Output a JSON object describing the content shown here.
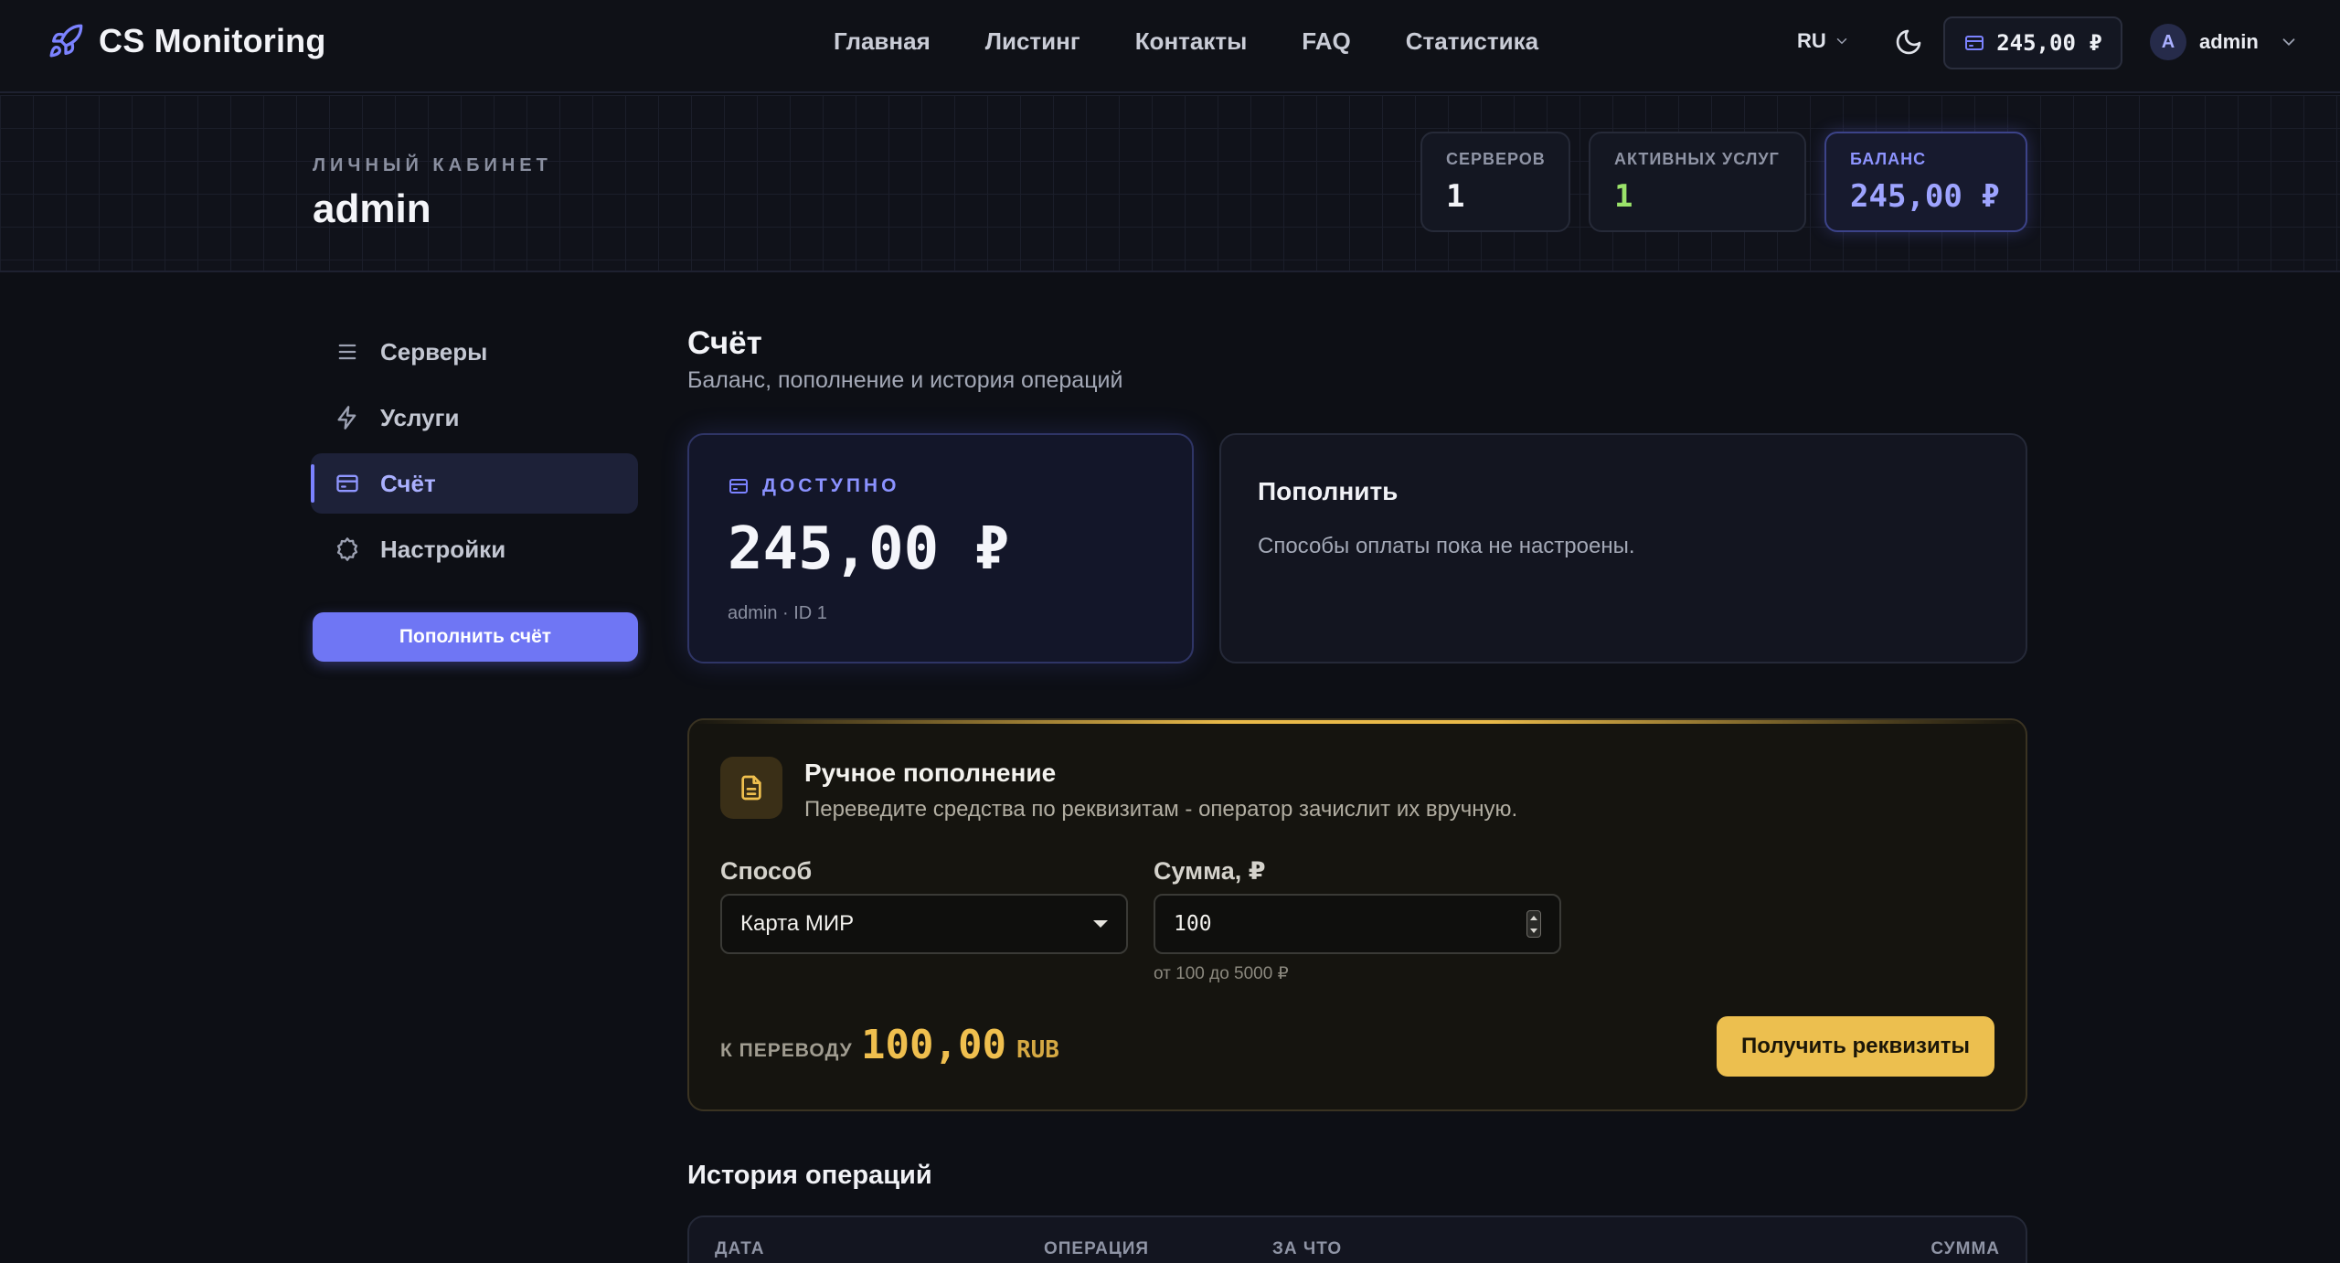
{
  "app": {
    "name": "CS Monitoring"
  },
  "nav": {
    "items": [
      "Главная",
      "Листинг",
      "Контакты",
      "FAQ",
      "Статистика"
    ]
  },
  "header": {
    "lang": "RU",
    "balance": "245,00 ₽",
    "user_initial": "A",
    "user_name": "admin"
  },
  "band": {
    "kicker": "ЛИЧНЫЙ КАБИНЕТ",
    "title": "admin",
    "stats": [
      {
        "label": "СЕРВЕРОВ",
        "value": "1"
      },
      {
        "label": "АКТИВНЫХ УСЛУГ",
        "value": "1"
      },
      {
        "label": "БАЛАНС",
        "value": "245,00 ₽"
      }
    ]
  },
  "sidebar": {
    "items": [
      {
        "label": "Серверы",
        "icon": "list-icon"
      },
      {
        "label": "Услуги",
        "icon": "bolt-icon"
      },
      {
        "label": "Счёт",
        "icon": "card-icon",
        "active": true
      },
      {
        "label": "Настройки",
        "icon": "gear-icon"
      }
    ],
    "button": "Пополнить счёт"
  },
  "main": {
    "title": "Счёт",
    "subtitle": "Баланс, пополнение и история операций",
    "available": {
      "label": "ДОСТУПНО",
      "amount": "245,00 ₽",
      "meta": "admin · ID 1"
    },
    "topup": {
      "title": "Пополнить",
      "text": "Способы оплаты пока не настроены."
    },
    "manual": {
      "title": "Ручное пополнение",
      "subtitle": "Переведите средства по реквизитам - оператор зачислит их вручную.",
      "method_label": "Способ",
      "method_value": "Карта МИР",
      "amount_label": "Сумма, ₽",
      "amount_value": "100",
      "range_hint": "от 100 до 5000 ₽",
      "transfer_label": "К ПЕРЕВОДУ",
      "transfer_amount": "100,00",
      "transfer_currency": "RUB",
      "button": "Получить реквизиты"
    },
    "history": {
      "title": "История операций",
      "columns": [
        "ДАТА",
        "ОПЕРАЦИЯ",
        "ЗА ЧТО",
        "СУММА"
      ]
    }
  },
  "colors": {
    "accent": "#7b82ff",
    "gold": "#ecbf4f",
    "success": "#9be36a",
    "background": "#0d0f15"
  }
}
